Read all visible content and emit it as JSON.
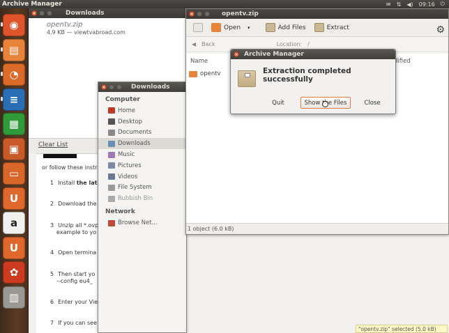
{
  "top_panel": {
    "app_title": "Archive Manager",
    "clock": "09:16"
  },
  "launcher": {
    "items": [
      {
        "name": "dash-home-icon",
        "color": "#e0542c",
        "glyph": "◉"
      },
      {
        "name": "files-icon",
        "color": "#e8833a",
        "glyph": "▤"
      },
      {
        "name": "firefox-icon",
        "color": "#dc6a28",
        "glyph": "◔"
      },
      {
        "name": "writer-icon",
        "color": "#2a6fb6",
        "glyph": "≡"
      },
      {
        "name": "calc-icon",
        "color": "#2f9a3a",
        "glyph": "▦"
      },
      {
        "name": "impress-icon",
        "color": "#c85a2a",
        "glyph": "▣"
      },
      {
        "name": "software-center-icon",
        "color": "#d9672a",
        "glyph": "▭"
      },
      {
        "name": "ubuntu-one-icon",
        "color": "#e0682c",
        "glyph": "U"
      },
      {
        "name": "amazon-icon",
        "color": "#f0f0ee",
        "glyph": "a"
      },
      {
        "name": "ubuntu-one-music-icon",
        "color": "#e0682c",
        "glyph": "U"
      },
      {
        "name": "system-settings-icon",
        "color": "#cc3a20",
        "glyph": "✿"
      },
      {
        "name": "archive-manager-icon",
        "color": "#9a9892",
        "glyph": "▥"
      }
    ]
  },
  "downloads_window": {
    "title": "Downloads",
    "item_name": "opentv.zip",
    "item_meta": "4.9 KB — viewtvabroad.com",
    "clear_list": "Clear List"
  },
  "webpage": {
    "intro": "or follow these instru",
    "steps": [
      {
        "num": "1",
        "text": "Install ",
        "bold": "the lat"
      },
      {
        "num": "2",
        "text": "Download the",
        "bold": ""
      },
      {
        "num": "3",
        "text": "Unzip all *.ovp",
        "bold": "",
        "line2": "example to yo"
      },
      {
        "num": "4",
        "text": "Open termina",
        "bold": ""
      },
      {
        "num": "5",
        "text": "Then start yo",
        "bold": "",
        "line2": "--config eu4_"
      },
      {
        "num": "6",
        "text": "Enter your Vie",
        "bold": ""
      },
      {
        "num": "7",
        "text": "If you can see",
        "bold": ""
      }
    ]
  },
  "nautilus": {
    "title": "Downloads",
    "computer_heading": "Computer",
    "network_heading": "Network",
    "items": [
      {
        "label": "Home",
        "color": "#c0392b"
      },
      {
        "label": "Desktop",
        "color": "#555555"
      },
      {
        "label": "Documents",
        "color": "#8a8a8a"
      },
      {
        "label": "Downloads",
        "color": "#6b8fb4"
      },
      {
        "label": "Music",
        "color": "#a07ab0"
      },
      {
        "label": "Pictures",
        "color": "#7a8aa0"
      },
      {
        "label": "Videos",
        "color": "#6a7a90"
      },
      {
        "label": "File System",
        "color": "#9a9a9a"
      },
      {
        "label": "Rubbish Bin",
        "color": "#aaaaaa"
      }
    ],
    "network_items": [
      {
        "label": "Browse Net...",
        "color": "#c04a3a"
      }
    ]
  },
  "archive_manager": {
    "title": "opentv.zip",
    "toolbar": {
      "open": "Open",
      "add_files": "Add Files",
      "extract": "Extract"
    },
    "nav": {
      "back": "Back",
      "location": "Location:",
      "path": "/"
    },
    "columns": {
      "name": "Name",
      "modified": "dified"
    },
    "rows": [
      {
        "name": "opentv"
      }
    ],
    "status": "1 object (6.0 kB)"
  },
  "dialog": {
    "title": "Archive Manager",
    "message": "Extraction completed successfully",
    "buttons": {
      "quit": "Quit",
      "show_files": "Show the Files",
      "close": "Close"
    }
  },
  "notification": "\"opentv.zip\" selected (5.0 kB)"
}
